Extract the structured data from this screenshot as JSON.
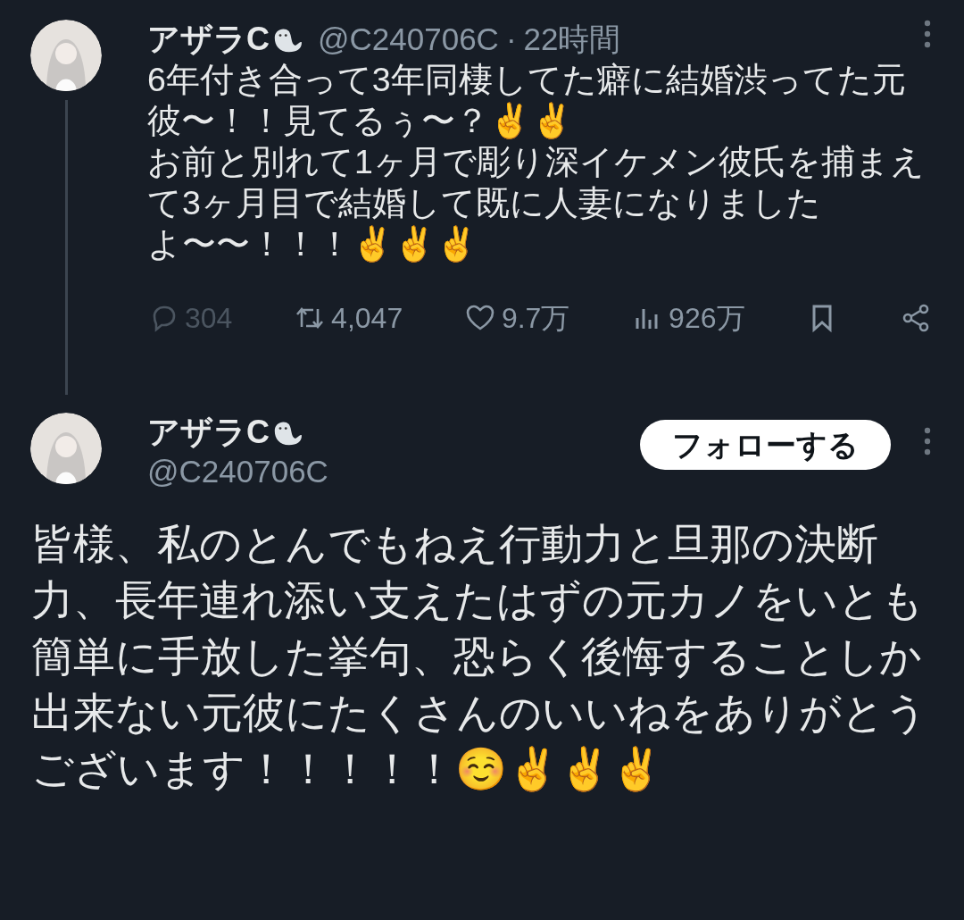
{
  "tweets": [
    {
      "name": "アザラC",
      "handle": "@C240706C",
      "time": "22時間",
      "separator": "·",
      "text": [
        "6年付き合って3年同棲してた癖に結婚渋ってた元彼〜！！見てるぅ〜？✌️✌️",
        "お前と別れて1ヶ月で彫り深イケメン彼氏を捕まえて3ヶ月目で結婚して既に人妻になりましたよ〜〜！！！✌️✌️✌️"
      ],
      "actions": [
        {
          "kind": "reply",
          "count": "304",
          "disabled": true
        },
        {
          "kind": "retweet",
          "count": "4,047",
          "disabled": false
        },
        {
          "kind": "like",
          "count": "9.7万",
          "disabled": false
        },
        {
          "kind": "views",
          "count": "926万",
          "disabled": false
        },
        {
          "kind": "bookmark",
          "disabled": false
        },
        {
          "kind": "share",
          "disabled": false
        }
      ]
    },
    {
      "name": "アザラC",
      "handle": "@C240706C",
      "follow_button": "フォローする",
      "text": [
        "皆様、私のとんでもねえ行動力と旦那の決断力、長年連れ添い支えたはずの元カノをいとも簡単に手放した挙句、恐らく後悔することしか出来ない元彼にたくさんのいいねをありがとうございます！！！！！☺️✌️✌️✌️"
      ]
    }
  ]
}
